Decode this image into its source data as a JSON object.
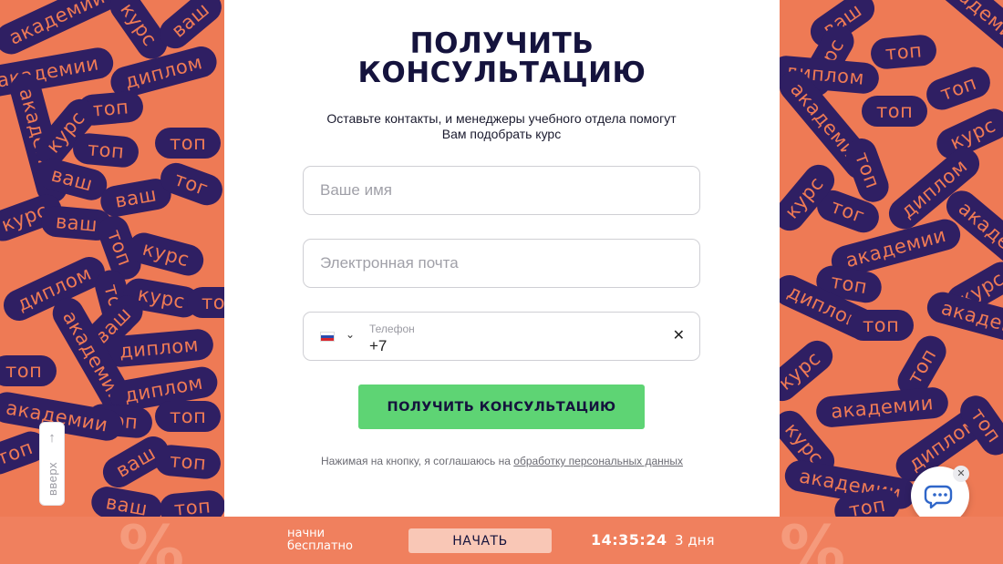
{
  "pattern": {
    "left": [
      "академии",
      "курс",
      "ваш",
      "академии",
      "диплом",
      "топ",
      "академии",
      "курс",
      "топ",
      "топ",
      "ваш",
      "ваш",
      "тог",
      "курс",
      "ваш",
      "топ",
      "курс",
      "диплом",
      "топ",
      "курс",
      "ваш",
      "топ",
      "диплом",
      "академии",
      "топ",
      "диплом",
      "топ",
      "топ",
      "академии",
      "топ",
      "ваш",
      "топ",
      "ваш",
      "топ"
    ],
    "right": [
      "ваш",
      "топ",
      "академии",
      "курс",
      "диплом",
      "топ",
      "академии",
      "курс",
      "топ",
      "топ",
      "тог",
      "диплом",
      "курс",
      "академии",
      "академии",
      "топ",
      "диплом",
      "курс",
      "топ",
      "академии",
      "топ",
      "курс",
      "академии",
      "диплом",
      "топ",
      "курс",
      "академии",
      "топ"
    ]
  },
  "form": {
    "title_line1": "ПОЛУЧИТЬ",
    "title_line2": "КОНСУЛЬТАЦИЮ",
    "subtitle": "Оставьте контакты, и менеджеры учебного отдела помогут Вам подобрать курс",
    "name_placeholder": "Ваше имя",
    "email_placeholder": "Электронная почта",
    "phone_label": "Телефон",
    "phone_value": "+7",
    "submit_label": "ПОЛУЧИТЬ КОНСУЛЬТАЦИЮ",
    "consent_text": "Нажимая на кнопку, я соглашаюсь на ",
    "consent_link": "обработку персональных данных"
  },
  "scroll_up": {
    "label": "вверх"
  },
  "bottom_bar": {
    "promo_line1": "начни",
    "promo_line2": "бесплатно",
    "start_label": "НАЧАТЬ",
    "timer": "14:35:24",
    "days": "3 дня"
  },
  "colors": {
    "pattern_bg": "#ee7a55",
    "pill": "#2f1f63",
    "title": "#15133d",
    "submit": "#5ed474",
    "bar": "#f0805e"
  }
}
